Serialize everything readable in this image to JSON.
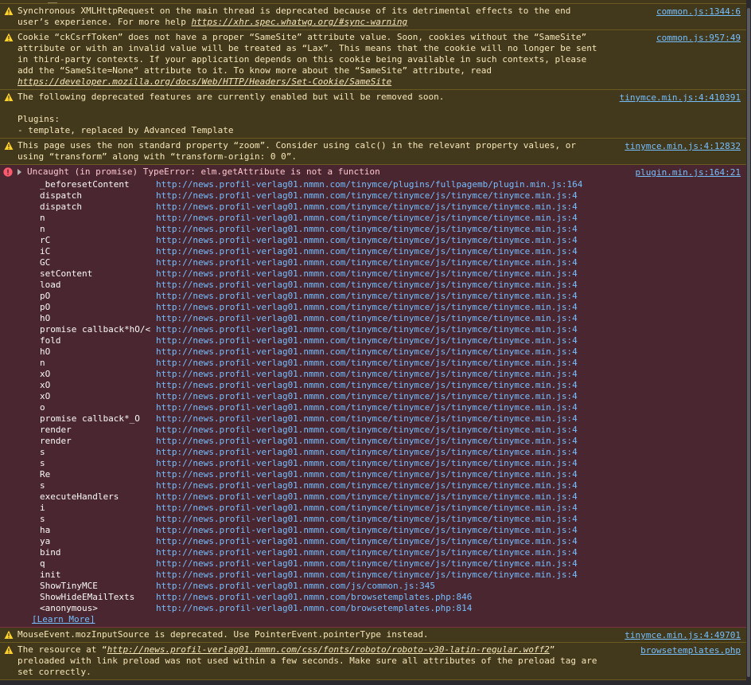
{
  "messages": [
    {
      "kind": "warn",
      "lines": [
        "Synchronous XMLHttpRequest on the main thread is deprecated because of its detrimental effects to the end user’s experience. For more help "
      ],
      "link": "https://xhr.spec.whatwg.org/#sync-warning",
      "source": "common.js:1344:6"
    },
    {
      "kind": "warn",
      "text_a": "Cookie “ckCsrfToken” does not have a proper “SameSite” attribute value. Soon, cookies without the “SameSite” attribute or with an invalid value will be treated as “Lax”. This means that the cookie will no longer be sent in third-party contexts. If your application depends on this cookie being available in such contexts, please add the “SameSite=None“ attribute to it. To know more about the “SameSite” attribute, read ",
      "link": "https://developer.mozilla.org/docs/Web/HTTP/Headers/Set-Cookie/SameSite",
      "source": "common.js:957:49"
    },
    {
      "kind": "warn",
      "line1": "The following deprecated features are currently enabled but will be removed soon.",
      "line2": "Plugins:",
      "line3": "- template, replaced by Advanced Template",
      "source": "tinymce.min.js:4:410391"
    },
    {
      "kind": "warn",
      "text": "This page uses the non standard property “zoom”. Consider using calc() in the relevant property values, or using “transform” along with “transform-origin: 0 0”.",
      "source": "tinymce.min.js:4:12832"
    },
    {
      "kind": "error",
      "text": "Uncaught (in promise) TypeError: elm.getAttribute is not a function",
      "source": "plugin.min.js:164:21",
      "learn_more": "[Learn More]"
    },
    {
      "kind": "warn",
      "text": "MouseEvent.mozInputSource is deprecated. Use PointerEvent.pointerType instead.",
      "source": "tinymce.min.js:4:49701"
    },
    {
      "kind": "warn",
      "text_a": "The resource at “",
      "link": "http://news.profil-verlag01.nmmn.com/css/fonts/roboto/roboto-v30-latin-regular.woff2",
      "text_b": "” preloaded with link preload was not used within a few seconds. Make sure all attributes of the preload tag are set correctly.",
      "source": "browsetemplates.php"
    }
  ],
  "stack": [
    {
      "fn": "_beforesetContent",
      "loc": "http://news.profil-verlag01.nmmn.com/tinymce/plugins/fullpagemb/plugin.min.js:164"
    },
    {
      "fn": "dispatch",
      "loc": "http://news.profil-verlag01.nmmn.com/tinymce/tinymce/js/tinymce/tinymce.min.js:4"
    },
    {
      "fn": "dispatch",
      "loc": "http://news.profil-verlag01.nmmn.com/tinymce/tinymce/js/tinymce/tinymce.min.js:4"
    },
    {
      "fn": "n",
      "loc": "http://news.profil-verlag01.nmmn.com/tinymce/tinymce/js/tinymce/tinymce.min.js:4"
    },
    {
      "fn": "n",
      "loc": "http://news.profil-verlag01.nmmn.com/tinymce/tinymce/js/tinymce/tinymce.min.js:4"
    },
    {
      "fn": "rC",
      "loc": "http://news.profil-verlag01.nmmn.com/tinymce/tinymce/js/tinymce/tinymce.min.js:4"
    },
    {
      "fn": "iC",
      "loc": "http://news.profil-verlag01.nmmn.com/tinymce/tinymce/js/tinymce/tinymce.min.js:4"
    },
    {
      "fn": "GC",
      "loc": "http://news.profil-verlag01.nmmn.com/tinymce/tinymce/js/tinymce/tinymce.min.js:4"
    },
    {
      "fn": "setContent",
      "loc": "http://news.profil-verlag01.nmmn.com/tinymce/tinymce/js/tinymce/tinymce.min.js:4"
    },
    {
      "fn": "load",
      "loc": "http://news.profil-verlag01.nmmn.com/tinymce/tinymce/js/tinymce/tinymce.min.js:4"
    },
    {
      "fn": "pO",
      "loc": "http://news.profil-verlag01.nmmn.com/tinymce/tinymce/js/tinymce/tinymce.min.js:4"
    },
    {
      "fn": "pO",
      "loc": "http://news.profil-verlag01.nmmn.com/tinymce/tinymce/js/tinymce/tinymce.min.js:4"
    },
    {
      "fn": "hO",
      "loc": "http://news.profil-verlag01.nmmn.com/tinymce/tinymce/js/tinymce/tinymce.min.js:4"
    },
    {
      "fn": "promise callback*hO/<",
      "loc": "http://news.profil-verlag01.nmmn.com/tinymce/tinymce/js/tinymce/tinymce.min.js:4"
    },
    {
      "fn": "fold",
      "loc": "http://news.profil-verlag01.nmmn.com/tinymce/tinymce/js/tinymce/tinymce.min.js:4"
    },
    {
      "fn": "hO",
      "loc": "http://news.profil-verlag01.nmmn.com/tinymce/tinymce/js/tinymce/tinymce.min.js:4"
    },
    {
      "fn": "n",
      "loc": "http://news.profil-verlag01.nmmn.com/tinymce/tinymce/js/tinymce/tinymce.min.js:4"
    },
    {
      "fn": "xO",
      "loc": "http://news.profil-verlag01.nmmn.com/tinymce/tinymce/js/tinymce/tinymce.min.js:4"
    },
    {
      "fn": "xO",
      "loc": "http://news.profil-verlag01.nmmn.com/tinymce/tinymce/js/tinymce/tinymce.min.js:4"
    },
    {
      "fn": "xO",
      "loc": "http://news.profil-verlag01.nmmn.com/tinymce/tinymce/js/tinymce/tinymce.min.js:4"
    },
    {
      "fn": "o",
      "loc": "http://news.profil-verlag01.nmmn.com/tinymce/tinymce/js/tinymce/tinymce.min.js:4"
    },
    {
      "fn": "promise callback*_O",
      "loc": "http://news.profil-verlag01.nmmn.com/tinymce/tinymce/js/tinymce/tinymce.min.js:4"
    },
    {
      "fn": "render",
      "loc": "http://news.profil-verlag01.nmmn.com/tinymce/tinymce/js/tinymce/tinymce.min.js:4"
    },
    {
      "fn": "render",
      "loc": "http://news.profil-verlag01.nmmn.com/tinymce/tinymce/js/tinymce/tinymce.min.js:4"
    },
    {
      "fn": "s",
      "loc": "http://news.profil-verlag01.nmmn.com/tinymce/tinymce/js/tinymce/tinymce.min.js:4"
    },
    {
      "fn": "s",
      "loc": "http://news.profil-verlag01.nmmn.com/tinymce/tinymce/js/tinymce/tinymce.min.js:4"
    },
    {
      "fn": "Re",
      "loc": "http://news.profil-verlag01.nmmn.com/tinymce/tinymce/js/tinymce/tinymce.min.js:4"
    },
    {
      "fn": "s",
      "loc": "http://news.profil-verlag01.nmmn.com/tinymce/tinymce/js/tinymce/tinymce.min.js:4"
    },
    {
      "fn": "executeHandlers",
      "loc": "http://news.profil-verlag01.nmmn.com/tinymce/tinymce/js/tinymce/tinymce.min.js:4"
    },
    {
      "fn": "i",
      "loc": "http://news.profil-verlag01.nmmn.com/tinymce/tinymce/js/tinymce/tinymce.min.js:4"
    },
    {
      "fn": "s",
      "loc": "http://news.profil-verlag01.nmmn.com/tinymce/tinymce/js/tinymce/tinymce.min.js:4"
    },
    {
      "fn": "ha",
      "loc": "http://news.profil-verlag01.nmmn.com/tinymce/tinymce/js/tinymce/tinymce.min.js:4"
    },
    {
      "fn": "ya",
      "loc": "http://news.profil-verlag01.nmmn.com/tinymce/tinymce/js/tinymce/tinymce.min.js:4"
    },
    {
      "fn": "bind",
      "loc": "http://news.profil-verlag01.nmmn.com/tinymce/tinymce/js/tinymce/tinymce.min.js:4"
    },
    {
      "fn": "q",
      "loc": "http://news.profil-verlag01.nmmn.com/tinymce/tinymce/js/tinymce/tinymce.min.js:4"
    },
    {
      "fn": "init",
      "loc": "http://news.profil-verlag01.nmmn.com/tinymce/tinymce/js/tinymce/tinymce.min.js:4"
    },
    {
      "fn": "ShowTinyMCE",
      "loc": "http://news.profil-verlag01.nmmn.com/js/common.js:345"
    },
    {
      "fn": "ShowHideEMailTexts",
      "loc": "http://news.profil-verlag01.nmmn.com/browsetemplates.php:846"
    },
    {
      "fn": "<anonymous>",
      "loc": "http://news.profil-verlag01.nmmn.com/browsetemplates.php:814"
    }
  ],
  "icons": {
    "warning": "warning-icon",
    "error": "error-icon",
    "expand": "expand-triangle-icon"
  },
  "colors": {
    "warn_bg": "#42381c",
    "error_bg": "#4a2630",
    "link": "#75bfff"
  }
}
